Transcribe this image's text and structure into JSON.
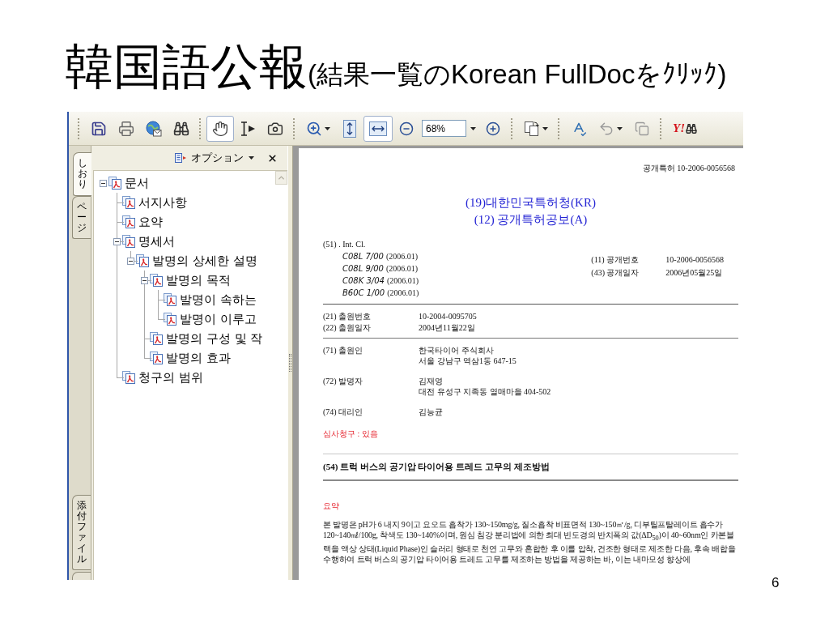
{
  "slide": {
    "title": "韓国語公報",
    "title_note": "(結果一覧のKorean FullDocをｸﾘｯｸ)",
    "page_number": "6"
  },
  "toolbar": {
    "tools": [
      {
        "selected": true
      },
      {
        "selected": false
      },
      {
        "selected": false
      }
    ],
    "fit_modes": [
      {
        "selected": false
      },
      {
        "selected": true
      }
    ],
    "zoom_field": {
      "value": "68%"
    },
    "logo_button": {
      "label": "Y!"
    }
  },
  "panel": {
    "tabs_top": [
      {
        "label": "しおり",
        "selected": true
      },
      {
        "label": "ページ",
        "selected": false
      }
    ],
    "tabs_bottom": [
      {
        "label": "添付ファイル",
        "selected": false
      }
    ],
    "options_button": {
      "label": "オプション"
    },
    "bookmarks": [
      {
        "label": "문서",
        "expanded": true,
        "children": [
          {
            "label": "서지사항"
          },
          {
            "label": "요약"
          },
          {
            "label": "명세서",
            "expanded": true,
            "children": [
              {
                "label": "발명의 상세한 설명",
                "expanded": true,
                "children": [
                  {
                    "label": "발명의 목적",
                    "expanded": true,
                    "children": [
                      {
                        "label": "발명이 속하는"
                      },
                      {
                        "label": "발명이 이루고"
                      }
                    ]
                  },
                  {
                    "label": "발명의 구성 및 작"
                  },
                  {
                    "label": "발명의 효과"
                  }
                ]
              }
            ]
          },
          {
            "label": "청구의 범위"
          }
        ]
      }
    ]
  },
  "document": {
    "header_number": "공개특허 10-2006-0056568",
    "office_title": "(19)대한민국특허청(KR)",
    "gazette_title": "(12) 공개특허공보(A)",
    "int_cl": {
      "label": "(51) . Int. Cl.",
      "classes": [
        {
          "code": "C08L 7/00",
          "version": "(2006.01)"
        },
        {
          "code": "C08L 9/00",
          "version": "(2006.01)"
        },
        {
          "code": "C08K 3/04",
          "version": "(2006.01)"
        },
        {
          "code": "B60C 1/00",
          "version": "(2006.01)"
        }
      ]
    },
    "publication": [
      {
        "label": "(11) 공개번호",
        "value": "10-2006-0056568"
      },
      {
        "label": "(43) 공개일자",
        "value": "2006년05월25일"
      }
    ],
    "application": [
      {
        "label": "(21) 출원번호",
        "value": "10-2004-0095705"
      },
      {
        "label": "(22) 출원일자",
        "value": "2004년11월22일"
      }
    ],
    "parties": [
      {
        "label": "(71) 출원인",
        "lines": [
          "한국타이어 주식회사",
          "서울 강남구 역삼1동 647-15"
        ]
      },
      {
        "label": "(72) 발명자",
        "lines": [
          "김재영",
          "대전 유성구 지족동 열매마을 404-502"
        ]
      },
      {
        "label": "(74) 대리인",
        "lines": [
          "김능균"
        ]
      }
    ],
    "examination_request": "심사청구 : 있음",
    "invention_title": "(54) 트럭 버스의 공기압 타이어용 트레드 고무의 제조방법",
    "abstract_heading": "요약",
    "abstract": "본 발명은 pH가 6 내지 9이고 요오드 흡착가 130~150mg/g, 질소흡착 비표면적 130~150㎡/g, 디부틸프탈레이트 흡수가 120~140㎖/100g, 착색도 130~140%이며, 원심 침강 분리법에 의한 최대 빈도경의 반치폭의 값(ΔD$_{50}$)이 40~60nm인 카본블랙을 액상 상태(Liquid Phase)인 슬러리 형태로 천연 고무와 혼합한 후 이를 압착, 건조한 형태로 제조한 다음, 후속 배합을 수행하여 트럭 버스의 공기압 타이어용 트레드 고무를 제조하는 방법을 제공하는 바, 이는 내마모성 향상에"
  }
}
